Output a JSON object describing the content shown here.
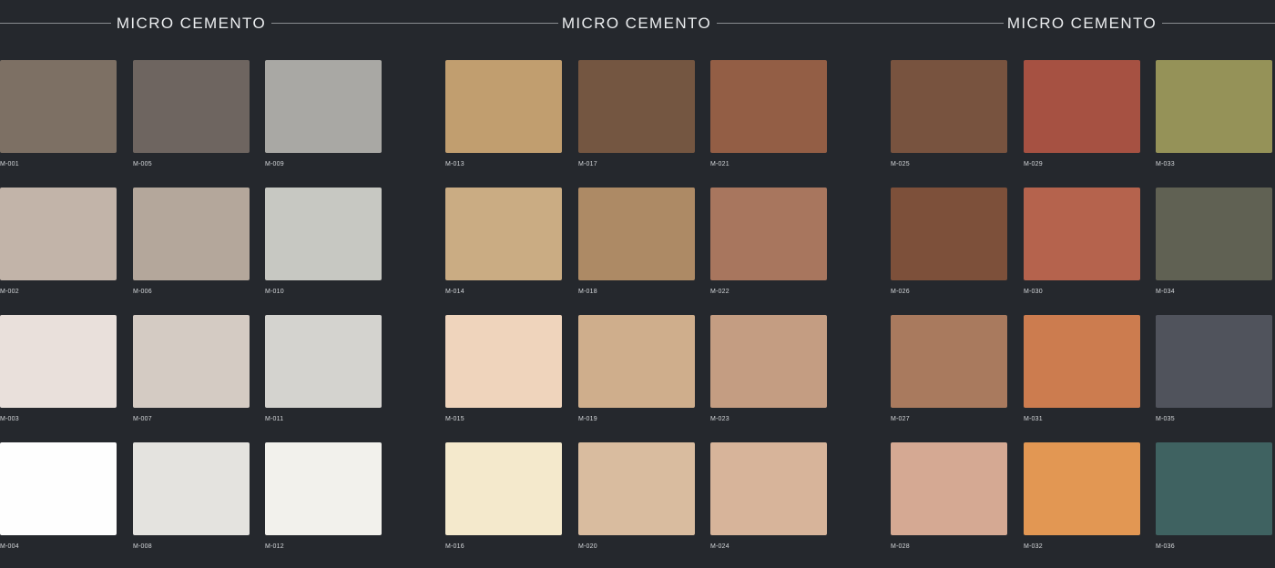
{
  "panels": [
    {
      "title": "MICRO CEMENTO",
      "columns": [
        [
          {
            "code": "M-001",
            "color": "#7d7064"
          },
          {
            "code": "M-002",
            "color": "#c2b4a9"
          },
          {
            "code": "M-003",
            "color": "#e9e0db"
          },
          {
            "code": "M-004",
            "color": "#fefefe"
          }
        ],
        [
          {
            "code": "M-005",
            "color": "#6e6560"
          },
          {
            "code": "M-006",
            "color": "#b4a79b"
          },
          {
            "code": "M-007",
            "color": "#d4cbc3"
          },
          {
            "code": "M-008",
            "color": "#e4e3df"
          }
        ],
        [
          {
            "code": "M-009",
            "color": "#a9a8a4"
          },
          {
            "code": "M-010",
            "color": "#c7c8c2"
          },
          {
            "code": "M-011",
            "color": "#d4d3cf"
          },
          {
            "code": "M-012",
            "color": "#f2f1ec"
          }
        ]
      ]
    },
    {
      "title": "MICRO CEMENTO",
      "columns": [
        [
          {
            "code": "M-013",
            "color": "#c19e6f"
          },
          {
            "code": "M-014",
            "color": "#caac83"
          },
          {
            "code": "M-015",
            "color": "#efd4bc"
          },
          {
            "code": "M-016",
            "color": "#f4e9cc"
          }
        ],
        [
          {
            "code": "M-017",
            "color": "#745641"
          },
          {
            "code": "M-018",
            "color": "#ad8a65"
          },
          {
            "code": "M-019",
            "color": "#cfae8c"
          },
          {
            "code": "M-020",
            "color": "#d9bc9f"
          }
        ],
        [
          {
            "code": "M-021",
            "color": "#935e45"
          },
          {
            "code": "M-022",
            "color": "#a8765e"
          },
          {
            "code": "M-023",
            "color": "#c49d82"
          },
          {
            "code": "M-024",
            "color": "#d7b49a"
          }
        ]
      ]
    },
    {
      "title": "MICRO CEMENTO",
      "columns": [
        [
          {
            "code": "M-025",
            "color": "#78533f"
          },
          {
            "code": "M-026",
            "color": "#7d503a"
          },
          {
            "code": "M-027",
            "color": "#a97a5e"
          },
          {
            "code": "M-028",
            "color": "#d5a993"
          }
        ],
        [
          {
            "code": "M-029",
            "color": "#a65142"
          },
          {
            "code": "M-030",
            "color": "#b5634d"
          },
          {
            "code": "M-031",
            "color": "#cc7c4f"
          },
          {
            "code": "M-032",
            "color": "#e29753"
          }
        ],
        [
          {
            "code": "M-033",
            "color": "#959258"
          },
          {
            "code": "M-034",
            "color": "#606153"
          },
          {
            "code": "M-035",
            "color": "#50535c"
          },
          {
            "code": "M-036",
            "color": "#3f6261"
          }
        ]
      ]
    }
  ]
}
